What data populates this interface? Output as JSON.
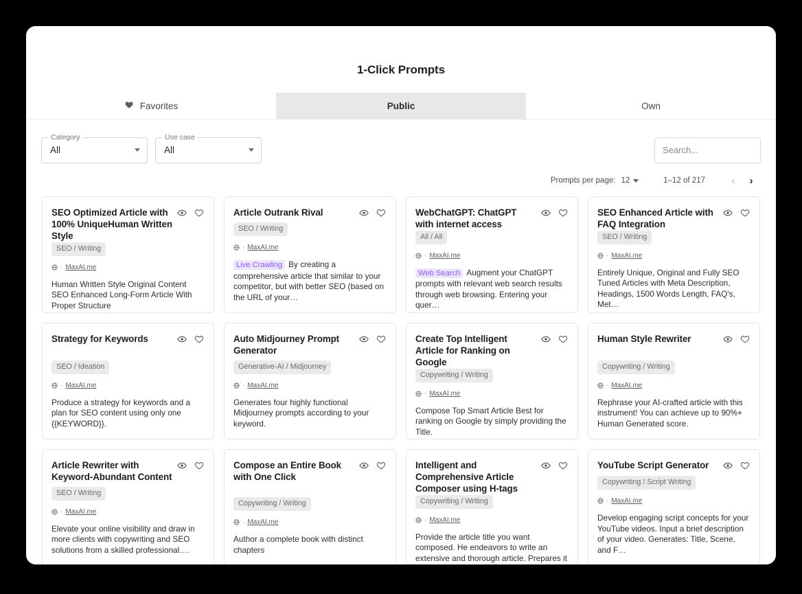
{
  "window": {
    "title": "1-Click Prompts"
  },
  "tabs": [
    {
      "label": "Favorites",
      "icon": "heart-icon",
      "active": false
    },
    {
      "label": "Public",
      "icon": "",
      "active": true
    },
    {
      "label": "Own",
      "icon": "",
      "active": false
    }
  ],
  "filters": {
    "category": {
      "label": "Category",
      "value": "All"
    },
    "use_case": {
      "label": "Use case",
      "value": "All"
    }
  },
  "search": {
    "placeholder": "Search...",
    "value": "",
    "icon": "search-icon"
  },
  "paginator": {
    "per_page_label": "Prompts per page:",
    "per_page_value": "12",
    "range": "1–12 of 217",
    "prev_icon": "‹",
    "next_icon": "›"
  },
  "cards": [
    {
      "title": "SEO Optimized Article with 100% UniqueHuman Written Style",
      "tag": "SEO / Writing",
      "author": "MaxAI.me",
      "badge": "",
      "desc": "Human Written Style Original Content SEO Enhanced Long-Form Article With Proper Structure"
    },
    {
      "title": "Article Outrank Rival",
      "tag": "SEO / Writing",
      "author": "MaxAI.me",
      "badge": "Live Crawling",
      "desc": "By creating a comprehensive article that similar to your competitor, but with better SEO (based on the URL of your…"
    },
    {
      "title": "WebChatGPT: ChatGPT with internet access",
      "tag": "All / All",
      "author": "MaxAI.me",
      "badge": "Web Search",
      "desc": "Augment your ChatGPT prompts with relevant web search results through web browsing. Entering your quer…"
    },
    {
      "title": "SEO Enhanced Article with FAQ Integration",
      "tag": "SEO / Writing",
      "author": "MaxAI.me",
      "badge": "",
      "desc": "Entirely Unique, Original and Fully SEO Tuned Articles with Meta Description, Headings, 1500 Words Length, FAQ's, Met…"
    },
    {
      "title": "Strategy for Keywords",
      "tag": "SEO / Ideation",
      "author": "MaxAI.me",
      "badge": "",
      "desc": "Produce a strategy for keywords and a plan for SEO content using only one {{KEYWORD}}."
    },
    {
      "title": "Auto Midjourney Prompt Generator",
      "tag": "Generative-AI / Midjourney",
      "author": "MaxAI.me",
      "badge": "",
      "desc": "Generates four highly functional Midjourney prompts according to your keyword."
    },
    {
      "title": "Create Top Intelligent Article for Ranking on Google",
      "tag": "Copywriting / Writing",
      "author": "MaxAI.me",
      "badge": "",
      "desc": "Compose Top Smart Article Best for ranking on Google by simply providing the Title."
    },
    {
      "title": "Human Style Rewriter",
      "tag": "Copywriting / Writing",
      "author": "MaxAI.me",
      "badge": "",
      "desc": "Rephrase your AI-crafted article with this instrument! You can achieve up to 90%+ Human Generated score."
    },
    {
      "title": "Article Rewriter with Keyword-Abundant Content",
      "tag": "SEO / Writing",
      "author": "MaxAI.me",
      "badge": "",
      "desc": "Elevate your online visibility and draw in more clients with copywriting and SEO solutions from a skilled professional.…"
    },
    {
      "title": "Compose an Entire Book with One Click",
      "tag": "Copywriting / Writing",
      "author": "MaxAI.me",
      "badge": "",
      "desc": "Author a complete book with distinct chapters"
    },
    {
      "title": "Intelligent and Comprehensive Article Composer using H-tags",
      "tag": "Copywriting / Writing",
      "author": "MaxAI.me",
      "badge": "",
      "desc": "Provide the article title you want composed. He endeavors to write an extensive and thorough article. Prepares it for sharing wi…"
    },
    {
      "title": "YouTube Script Generator",
      "tag": "Copywriting / Script Writing",
      "author": "MaxAI.me",
      "badge": "",
      "desc": "Develop engaging script concepts for your YouTube videos. Input a brief description of your video. Generates: Title, Scene, and F…"
    }
  ],
  "colors": {
    "badge_purple_text": "#8b5cf6",
    "badge_purple_bg": "#ece4fb",
    "tag_bg": "#eaeaea",
    "active_tab_bg": "#e8e8e8"
  }
}
